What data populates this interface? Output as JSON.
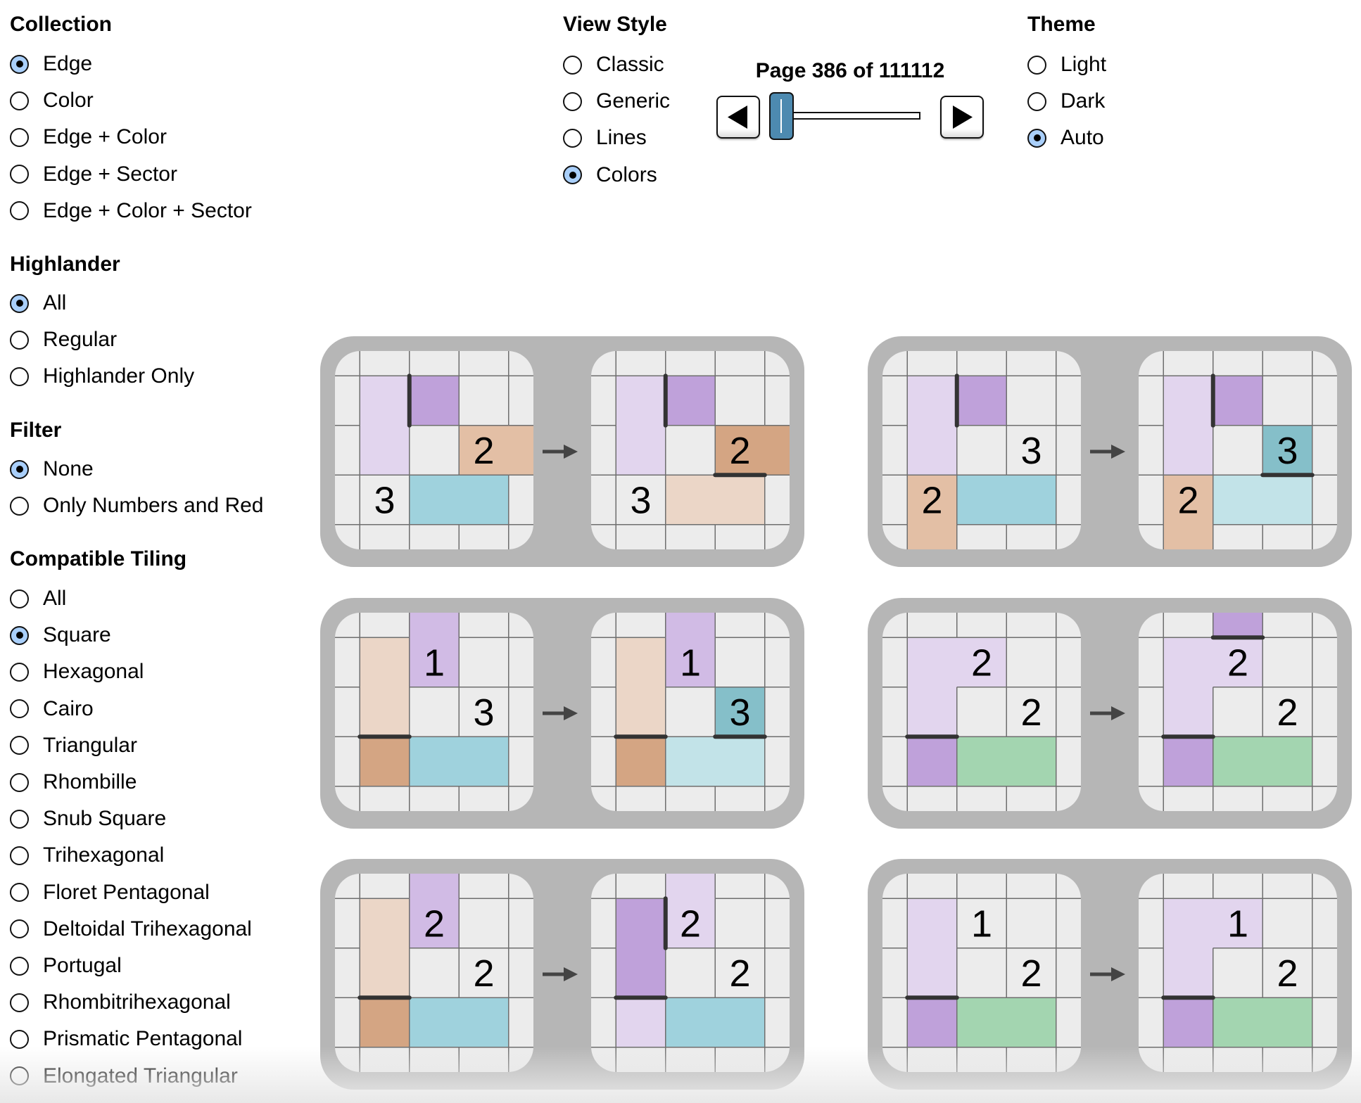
{
  "collection": {
    "title": "Collection",
    "options": [
      {
        "label": "Edge",
        "selected": true
      },
      {
        "label": "Color",
        "selected": false
      },
      {
        "label": "Edge + Color",
        "selected": false
      },
      {
        "label": "Edge + Sector",
        "selected": false
      },
      {
        "label": "Edge + Color + Sector",
        "selected": false
      }
    ]
  },
  "highlander": {
    "title": "Highlander",
    "options": [
      {
        "label": "All",
        "selected": true
      },
      {
        "label": "Regular",
        "selected": false
      },
      {
        "label": "Highlander Only",
        "selected": false
      }
    ]
  },
  "filter": {
    "title": "Filter",
    "options": [
      {
        "label": "None",
        "selected": true
      },
      {
        "label": "Only Numbers and Red",
        "selected": false
      }
    ]
  },
  "compatible_tiling": {
    "title": "Compatible Tiling",
    "options": [
      {
        "label": "All",
        "selected": false
      },
      {
        "label": "Square",
        "selected": true
      },
      {
        "label": "Hexagonal",
        "selected": false
      },
      {
        "label": "Cairo",
        "selected": false
      },
      {
        "label": "Triangular",
        "selected": false
      },
      {
        "label": "Rhombille",
        "selected": false
      },
      {
        "label": "Snub Square",
        "selected": false
      },
      {
        "label": "Trihexagonal",
        "selected": false
      },
      {
        "label": "Floret Pentagonal",
        "selected": false
      },
      {
        "label": "Deltoidal Trihexagonal",
        "selected": false
      },
      {
        "label": "Portugal",
        "selected": false
      },
      {
        "label": "Rhombitrihexagonal",
        "selected": false
      },
      {
        "label": "Prismatic Pentagonal",
        "selected": false
      },
      {
        "label": "Elongated Triangular",
        "selected": false
      }
    ]
  },
  "view_style": {
    "title": "View Style",
    "options": [
      {
        "label": "Classic",
        "selected": false
      },
      {
        "label": "Generic",
        "selected": false
      },
      {
        "label": "Lines",
        "selected": false
      },
      {
        "label": "Colors",
        "selected": true
      }
    ]
  },
  "theme": {
    "title": "Theme",
    "options": [
      {
        "label": "Light",
        "selected": false
      },
      {
        "label": "Dark",
        "selected": false
      },
      {
        "label": "Auto",
        "selected": true
      }
    ]
  },
  "pager": {
    "label": "Page 386 of 111112",
    "current_page": 386,
    "total_pages": 111112,
    "prev_icon": "triangle-left-icon",
    "next_icon": "triangle-right-icon",
    "slider_accent": "#4d8ab0"
  },
  "colors": {
    "cell_bg": "#ececec",
    "grid_line": "#6e6e6e",
    "bold_edge": "#333333",
    "card_bg": "#b6b6b6",
    "arrow": "#444444",
    "radio_selected": "#a9cffa",
    "lightPurple": "#e2d5ee",
    "purple": "#bfa1da",
    "midPurple": "#d1bbe5",
    "peach": "#e3bfa5",
    "darkPeach": "#d4a583",
    "lightPeach": "#ebd6c7",
    "blue": "#9fd2dd",
    "lightBlue": "#c2e3e8",
    "teal": "#85bfc9",
    "green": "#a3d5b0"
  },
  "rules": [
    {
      "before": {
        "regions": [
          {
            "color": "lightPurple",
            "cells": [
              [
                1,
                1
              ],
              [
                2,
                1
              ]
            ]
          },
          {
            "color": "purple",
            "cells": [
              [
                1,
                2
              ]
            ]
          },
          {
            "color": "peach",
            "cells": [
              [
                2,
                3
              ],
              [
                2,
                4
              ]
            ]
          },
          {
            "color": "blue",
            "cells": [
              [
                3,
                2
              ],
              [
                3,
                3
              ]
            ]
          }
        ],
        "numbers": [
          {
            "row": 2,
            "col": 3,
            "value": "2"
          },
          {
            "row": 3,
            "col": 1,
            "value": "3"
          }
        ],
        "edges": [
          {
            "dir": "v",
            "row": 1,
            "col": 2
          }
        ]
      },
      "after": {
        "regions": [
          {
            "color": "lightPurple",
            "cells": [
              [
                1,
                1
              ],
              [
                2,
                1
              ]
            ]
          },
          {
            "color": "purple",
            "cells": [
              [
                1,
                2
              ]
            ]
          },
          {
            "color": "darkPeach",
            "cells": [
              [
                2,
                3
              ],
              [
                2,
                4
              ]
            ]
          },
          {
            "color": "lightPeach",
            "cells": [
              [
                3,
                2
              ],
              [
                3,
                3
              ]
            ]
          }
        ],
        "numbers": [
          {
            "row": 2,
            "col": 3,
            "value": "2"
          },
          {
            "row": 3,
            "col": 1,
            "value": "3"
          }
        ],
        "edges": [
          {
            "dir": "v",
            "row": 1,
            "col": 2
          },
          {
            "dir": "h",
            "row": 3,
            "col": 3
          }
        ]
      }
    },
    {
      "before": {
        "regions": [
          {
            "color": "lightPurple",
            "cells": [
              [
                1,
                1
              ],
              [
                2,
                1
              ]
            ]
          },
          {
            "color": "purple",
            "cells": [
              [
                1,
                2
              ]
            ]
          },
          {
            "color": "peach",
            "cells": [
              [
                3,
                1
              ],
              [
                4,
                1
              ]
            ]
          },
          {
            "color": "blue",
            "cells": [
              [
                3,
                2
              ],
              [
                3,
                3
              ]
            ]
          }
        ],
        "numbers": [
          {
            "row": 2,
            "col": 3,
            "value": "3"
          },
          {
            "row": 3,
            "col": 1,
            "value": "2"
          }
        ],
        "edges": [
          {
            "dir": "v",
            "row": 1,
            "col": 2
          }
        ]
      },
      "after": {
        "regions": [
          {
            "color": "lightPurple",
            "cells": [
              [
                1,
                1
              ],
              [
                2,
                1
              ]
            ]
          },
          {
            "color": "purple",
            "cells": [
              [
                1,
                2
              ]
            ]
          },
          {
            "color": "teal",
            "cells": [
              [
                2,
                3
              ]
            ]
          },
          {
            "color": "peach",
            "cells": [
              [
                3,
                1
              ],
              [
                4,
                1
              ]
            ]
          },
          {
            "color": "lightBlue",
            "cells": [
              [
                3,
                2
              ],
              [
                3,
                3
              ]
            ]
          }
        ],
        "numbers": [
          {
            "row": 2,
            "col": 3,
            "value": "3"
          },
          {
            "row": 3,
            "col": 1,
            "value": "2"
          }
        ],
        "edges": [
          {
            "dir": "v",
            "row": 1,
            "col": 2
          },
          {
            "dir": "h",
            "row": 3,
            "col": 3
          }
        ]
      }
    },
    {
      "before": {
        "regions": [
          {
            "color": "lightPeach",
            "cells": [
              [
                1,
                1
              ],
              [
                2,
                1
              ]
            ]
          },
          {
            "color": "midPurple",
            "cells": [
              [
                0,
                2
              ],
              [
                1,
                2
              ]
            ]
          },
          {
            "color": "darkPeach",
            "cells": [
              [
                3,
                1
              ]
            ]
          },
          {
            "color": "blue",
            "cells": [
              [
                3,
                2
              ],
              [
                3,
                3
              ]
            ]
          }
        ],
        "numbers": [
          {
            "row": 1,
            "col": 2,
            "value": "1"
          },
          {
            "row": 2,
            "col": 3,
            "value": "3"
          }
        ],
        "edges": [
          {
            "dir": "h",
            "row": 3,
            "col": 1
          }
        ]
      },
      "after": {
        "regions": [
          {
            "color": "lightPeach",
            "cells": [
              [
                1,
                1
              ],
              [
                2,
                1
              ]
            ]
          },
          {
            "color": "midPurple",
            "cells": [
              [
                0,
                2
              ],
              [
                1,
                2
              ]
            ]
          },
          {
            "color": "teal",
            "cells": [
              [
                2,
                3
              ]
            ]
          },
          {
            "color": "darkPeach",
            "cells": [
              [
                3,
                1
              ]
            ]
          },
          {
            "color": "lightBlue",
            "cells": [
              [
                3,
                2
              ],
              [
                3,
                3
              ]
            ]
          }
        ],
        "numbers": [
          {
            "row": 1,
            "col": 2,
            "value": "1"
          },
          {
            "row": 2,
            "col": 3,
            "value": "3"
          }
        ],
        "edges": [
          {
            "dir": "h",
            "row": 3,
            "col": 1
          },
          {
            "dir": "h",
            "row": 3,
            "col": 3
          }
        ]
      }
    },
    {
      "before": {
        "regions": [
          {
            "color": "lightPurple",
            "cells": [
              [
                1,
                1
              ],
              [
                1,
                2
              ],
              [
                2,
                1
              ]
            ]
          },
          {
            "color": "purple",
            "cells": [
              [
                3,
                1
              ]
            ]
          },
          {
            "color": "green",
            "cells": [
              [
                3,
                2
              ],
              [
                3,
                3
              ]
            ]
          }
        ],
        "numbers": [
          {
            "row": 1,
            "col": 2,
            "value": "2"
          },
          {
            "row": 2,
            "col": 3,
            "value": "2"
          }
        ],
        "edges": [
          {
            "dir": "h",
            "row": 3,
            "col": 1
          }
        ]
      },
      "after": {
        "regions": [
          {
            "color": "purple",
            "cells": [
              [
                0,
                2
              ]
            ]
          },
          {
            "color": "lightPurple",
            "cells": [
              [
                1,
                1
              ],
              [
                1,
                2
              ],
              [
                2,
                1
              ]
            ]
          },
          {
            "color": "purple",
            "cells": [
              [
                3,
                1
              ]
            ]
          },
          {
            "color": "green",
            "cells": [
              [
                3,
                2
              ],
              [
                3,
                3
              ]
            ]
          }
        ],
        "numbers": [
          {
            "row": 1,
            "col": 2,
            "value": "2"
          },
          {
            "row": 2,
            "col": 3,
            "value": "2"
          }
        ],
        "edges": [
          {
            "dir": "h",
            "row": 3,
            "col": 1
          },
          {
            "dir": "h",
            "row": 1,
            "col": 2
          }
        ]
      }
    },
    {
      "before": {
        "regions": [
          {
            "color": "lightPeach",
            "cells": [
              [
                1,
                1
              ],
              [
                2,
                1
              ]
            ]
          },
          {
            "color": "midPurple",
            "cells": [
              [
                0,
                2
              ],
              [
                1,
                2
              ]
            ]
          },
          {
            "color": "darkPeach",
            "cells": [
              [
                3,
                1
              ]
            ]
          },
          {
            "color": "blue",
            "cells": [
              [
                3,
                2
              ],
              [
                3,
                3
              ]
            ]
          }
        ],
        "numbers": [
          {
            "row": 1,
            "col": 2,
            "value": "2"
          },
          {
            "row": 2,
            "col": 3,
            "value": "2"
          }
        ],
        "edges": [
          {
            "dir": "h",
            "row": 3,
            "col": 1
          }
        ]
      },
      "after": {
        "regions": [
          {
            "color": "purple",
            "cells": [
              [
                1,
                1
              ],
              [
                2,
                1
              ]
            ]
          },
          {
            "color": "lightPurple",
            "cells": [
              [
                0,
                2
              ],
              [
                1,
                2
              ]
            ]
          },
          {
            "color": "lightPurple",
            "cells": [
              [
                3,
                1
              ]
            ]
          },
          {
            "color": "blue",
            "cells": [
              [
                3,
                2
              ],
              [
                3,
                3
              ]
            ]
          }
        ],
        "numbers": [
          {
            "row": 1,
            "col": 2,
            "value": "2"
          },
          {
            "row": 2,
            "col": 3,
            "value": "2"
          }
        ],
        "edges": [
          {
            "dir": "v",
            "row": 1,
            "col": 2
          },
          {
            "dir": "h",
            "row": 3,
            "col": 1
          }
        ]
      }
    },
    {
      "before": {
        "regions": [
          {
            "color": "lightPurple",
            "cells": [
              [
                1,
                1
              ],
              [
                2,
                1
              ]
            ]
          },
          {
            "color": "purple",
            "cells": [
              [
                3,
                1
              ]
            ]
          },
          {
            "color": "green",
            "cells": [
              [
                3,
                2
              ],
              [
                3,
                3
              ]
            ]
          }
        ],
        "numbers": [
          {
            "row": 1,
            "col": 2,
            "value": "1"
          },
          {
            "row": 2,
            "col": 3,
            "value": "2"
          }
        ],
        "edges": [
          {
            "dir": "h",
            "row": 3,
            "col": 1
          }
        ]
      },
      "after": {
        "regions": [
          {
            "color": "lightPurple",
            "cells": [
              [
                1,
                1
              ],
              [
                1,
                2
              ],
              [
                2,
                1
              ]
            ]
          },
          {
            "color": "purple",
            "cells": [
              [
                3,
                1
              ]
            ]
          },
          {
            "color": "green",
            "cells": [
              [
                3,
                2
              ],
              [
                3,
                3
              ]
            ]
          }
        ],
        "numbers": [
          {
            "row": 1,
            "col": 2,
            "value": "1"
          },
          {
            "row": 2,
            "col": 3,
            "value": "2"
          }
        ],
        "edges": [
          {
            "dir": "h",
            "row": 3,
            "col": 1
          }
        ]
      }
    }
  ]
}
